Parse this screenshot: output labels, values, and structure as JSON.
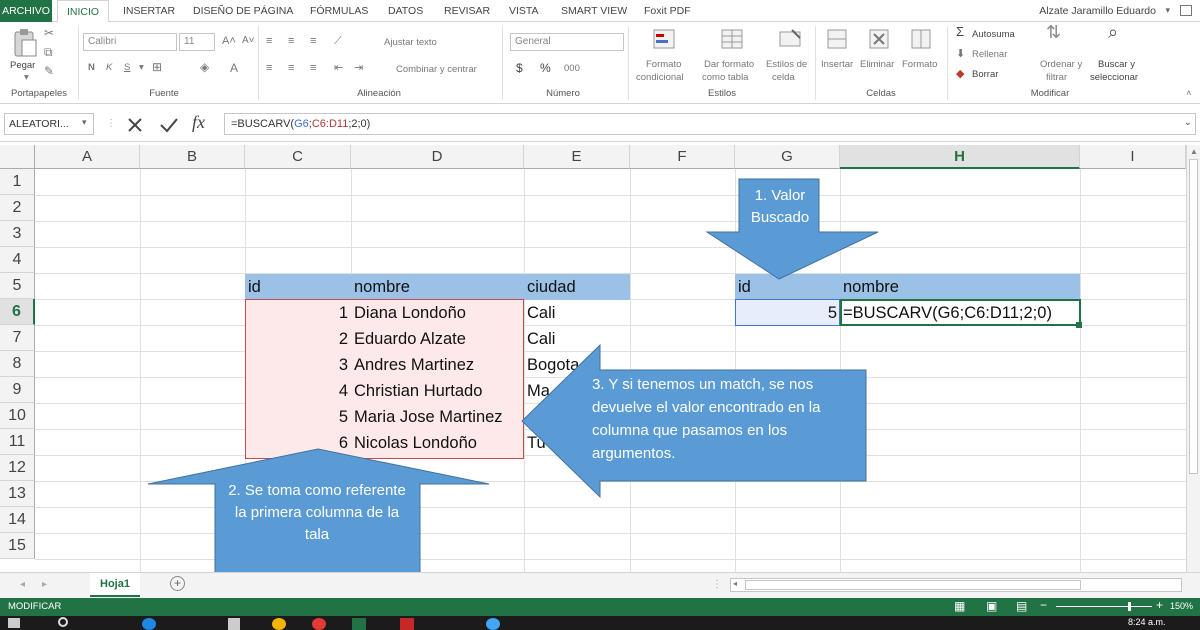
{
  "ribbon_tabs": [
    "ARCHIVO",
    "INICIO",
    "INSERTAR",
    "DISEÑO DE PÁGINA",
    "FÓRMULAS",
    "DATOS",
    "REVISAR",
    "VISTA",
    "SMART VIEW",
    "Foxit PDF"
  ],
  "user": "Alzate Jaramillo Eduardo",
  "ribbon": {
    "paste": "Pegar",
    "font_name": "Calibri",
    "font_size": "11",
    "bold": "N",
    "italic": "K",
    "underline": "S",
    "wrap_text": "Ajustar texto",
    "merge_center": "Combinar y centrar",
    "number_format": "General",
    "currency": "$",
    "percent": "%",
    "thousands": "000",
    "cond_format_1": "Formato",
    "cond_format_2": "condicional",
    "table_format_1": "Dar formato",
    "table_format_2": "como tabla",
    "cell_styles_1": "Estilos de",
    "cell_styles_2": "celda",
    "insert": "Insertar",
    "delete": "Eliminar",
    "format": "Formato",
    "autosum": "Autosuma",
    "fill": "Rellenar",
    "clear": "Borrar",
    "sort_1": "Ordenar y",
    "sort_2": "filtrar",
    "find_1": "Buscar y",
    "find_2": "seleccionar",
    "groups": {
      "clipboard": "Portapapeles",
      "font": "Fuente",
      "alignment": "Alineación",
      "number": "Número",
      "styles": "Estilos",
      "cells": "Celdas",
      "editing": "Modificar"
    }
  },
  "formula_bar": {
    "name_box": "ALEATORI...",
    "fx": "fx",
    "formula_prefix": "=BUSCARV(",
    "formula_ref1": "G6",
    "formula_sep1": ";",
    "formula_ref2": "C6:D11",
    "formula_suffix": ";2;0)"
  },
  "columns": [
    "A",
    "B",
    "C",
    "D",
    "E",
    "F",
    "G",
    "H",
    "I"
  ],
  "rows": [
    "1",
    "2",
    "3",
    "4",
    "5",
    "6",
    "7",
    "8",
    "9",
    "10",
    "11",
    "12",
    "13",
    "14",
    "15"
  ],
  "table": {
    "headers": [
      "id",
      "nombre",
      "ciudad"
    ],
    "rows": [
      {
        "id": "1",
        "nombre": "Diana Londoño",
        "ciudad": "Cali"
      },
      {
        "id": "2",
        "nombre": "Eduardo Alzate",
        "ciudad": "Cali"
      },
      {
        "id": "3",
        "nombre": "Andres Martinez",
        "ciudad": "Bogota"
      },
      {
        "id": "4",
        "nombre": "Christian Hurtado",
        "ciudad": "Ma"
      },
      {
        "id": "5",
        "nombre": "Maria Jose Martinez",
        "ciudad": ""
      },
      {
        "id": "6",
        "nombre": "Nicolas Londoño",
        "ciudad": "Tu"
      }
    ]
  },
  "lookup": {
    "header_id": "id",
    "header_name": "nombre",
    "value": "5",
    "formula": "=BUSCARV(G6;C6:D11;2;0)"
  },
  "callouts": {
    "c1": "1. Valor Buscado",
    "c2": "2. Se toma como referente la primera columna de la tala",
    "c3": "3. Y si tenemos un match, se nos devuelve el valor encontrado en la columna que pasamos en los argumentos."
  },
  "sheet_tab": "Hoja1",
  "status": {
    "mode": "MODIFICAR",
    "zoom": "150%",
    "time": "8:24 a.m."
  },
  "colors": {
    "excel_green": "#217346",
    "header_fill": "#9bc2e6",
    "table_fill": "#fde9e9",
    "callout": "#5b9bd5",
    "table_border": "#c0504d"
  }
}
